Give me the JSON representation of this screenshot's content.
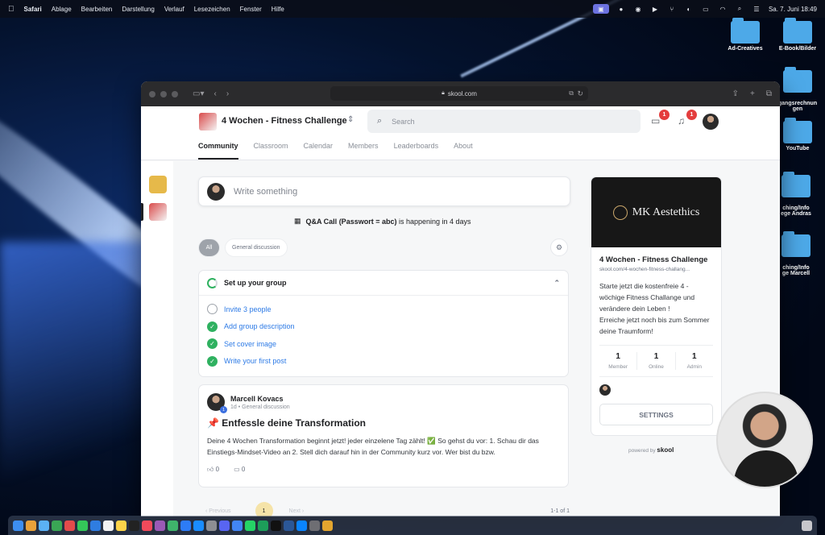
{
  "menubar": {
    "app": "Safari",
    "menus": [
      "Ablage",
      "Bearbeiten",
      "Darstellung",
      "Verlauf",
      "Lesezeichen",
      "Fenster",
      "Hilfe"
    ],
    "clock": "Sa. 7. Juni  18:49"
  },
  "desktop": {
    "icons": [
      {
        "label": "Ad-Creatives"
      },
      {
        "label": "E-Book/Bilder"
      },
      {
        "label": "gangsrechnun\ngen"
      },
      {
        "label": "YouTube"
      },
      {
        "label": "ching/Info\nege Andras"
      },
      {
        "label": "ching/Info\nge Marcell"
      }
    ]
  },
  "browser": {
    "url": "skool.com"
  },
  "header": {
    "group_name": "4 Wochen - Fitness Challenge",
    "search_placeholder": "Search",
    "chat_badge": "1",
    "notif_badge": "1",
    "tabs": [
      {
        "label": "Community",
        "active": true
      },
      {
        "label": "Classroom"
      },
      {
        "label": "Calendar"
      },
      {
        "label": "Members"
      },
      {
        "label": "Leaderboards"
      },
      {
        "label": "About"
      }
    ]
  },
  "feed": {
    "write_placeholder": "Write something",
    "event_title": "Q&A Call (Passwort = abc)",
    "event_suffix": "is happening in 4 days",
    "filters": [
      "All",
      "General discussion"
    ],
    "setup": {
      "title": "Set up your group",
      "tasks": [
        {
          "label": "Invite 3 people",
          "done": false
        },
        {
          "label": "Add group description",
          "done": true
        },
        {
          "label": "Set cover image",
          "done": true
        },
        {
          "label": "Write your first post",
          "done": true
        }
      ]
    },
    "post": {
      "author": "Marcell Kovacs",
      "level": "1",
      "meta": "1d • General discussion",
      "title": "📌 Entfessle deine Transformation",
      "body": "Deine 4 Wochen Transformation beginnt jetzt! jeder einzelene Tag zählt! ✅ So gehst du vor: 1. Schau dir das Einstiegs-Mindset-Video an 2. Stell dich darauf hin in der Community kurz vor. Wer bist du bzw.",
      "likes": "0",
      "comments": "0"
    },
    "pagination": {
      "previous": "‹ Previous",
      "current": "1",
      "next": "Next ›",
      "count": "1-1 of 1"
    }
  },
  "sidebar": {
    "cover_text": "MK Aestethics",
    "title": "4 Wochen - Fitness Challenge",
    "url": "skool.com/4-wochen-fitness-challang...",
    "description": "Starte jetzt die kostenfreie 4 -wöchige Fitness Challange und verändere dein Leben !\nErreiche jetzt noch bis zum Sommer deine Traumform!",
    "stats": [
      {
        "num": "1",
        "label": "Member"
      },
      {
        "num": "1",
        "label": "Online"
      },
      {
        "num": "1",
        "label": "Admin"
      }
    ],
    "settings_label": "SETTINGS",
    "powered_prefix": "powered by",
    "powered_brand": "skool"
  },
  "colors": {
    "accent_green": "#2fb160",
    "link_blue": "#2e7be6",
    "badge_red": "#e43d3d"
  }
}
